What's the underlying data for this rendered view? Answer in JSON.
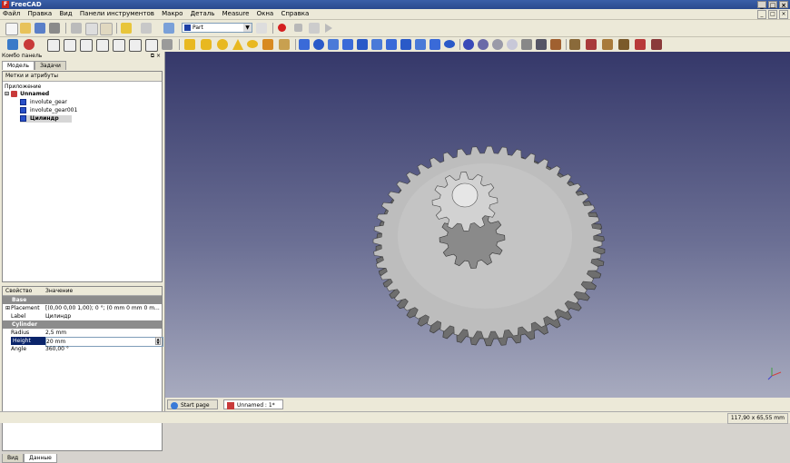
{
  "window": {
    "title": "FreeCAD"
  },
  "menu": [
    "Файл",
    "Правка",
    "Вид",
    "Панели инструментов",
    "Макро",
    "Деталь",
    "Меаsure",
    "Окна",
    "Справка"
  ],
  "toolbar": {
    "workbench": "Part"
  },
  "panel": {
    "title": "Комбо панель",
    "tabs": [
      "Модель",
      "Задачи"
    ],
    "tree_header": "Метки и атрибуты",
    "tree": {
      "root_label": "Приложение",
      "document": "Unnamed",
      "items": [
        "involute_gear",
        "involute_gear001",
        "Цилиндр"
      ]
    },
    "properties": {
      "columns": [
        "Свойство",
        "Значение"
      ],
      "groups": [
        {
          "name": "Base",
          "rows": [
            {
              "key": "Placement",
              "value": "[(0,00 0,00 1,00); 0 °; (0 mm  0 mm  0 m..."
            },
            {
              "key": "Label",
              "value": "Цилиндр"
            }
          ]
        },
        {
          "name": "Cylinder",
          "rows": [
            {
              "key": "Radius",
              "value": "2,5 mm"
            },
            {
              "key": "Height",
              "value": "20 mm"
            },
            {
              "key": "Angle",
              "value": "360,00 °"
            }
          ]
        }
      ]
    },
    "bottom_tabs": [
      "Вид",
      "Данные"
    ]
  },
  "view_tabs": [
    "Start page",
    "Unnamed : 1*"
  ],
  "status": {
    "coords": "117,90 x 65,55 mm"
  },
  "colors": {
    "view_top": "#35386a",
    "view_bottom": "#a8abbf",
    "gear": "#bdbdbd",
    "selection": "#0a246a"
  }
}
